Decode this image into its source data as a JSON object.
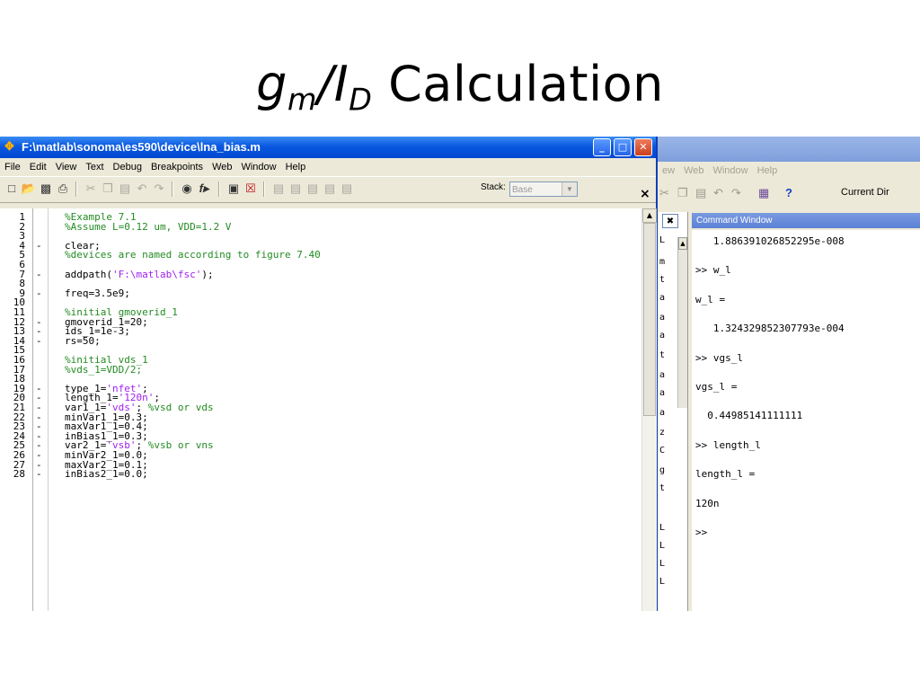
{
  "slide": {
    "title_main": "g",
    "title_sub_m": "m",
    "title_sep": "/I",
    "title_sub_d": "D",
    "title_rest": " Calculation"
  },
  "editor": {
    "title": "F:\\matlab\\sonoma\\es590\\device\\lna_bias.m",
    "window_buttons": [
      "_",
      "□",
      "✕"
    ],
    "menu": [
      "File",
      "Edit",
      "View",
      "Text",
      "Debug",
      "Breakpoints",
      "Web",
      "Window",
      "Help"
    ],
    "stack_label": "Stack:",
    "stack_value": "Base",
    "lines": [
      {
        "n": "1",
        "m": "",
        "code": [
          {
            "t": "%Example 7.1",
            "k": "cmt"
          }
        ]
      },
      {
        "n": "2",
        "m": "",
        "code": [
          {
            "t": "%Assume L=0.12 um, VDD=1.2 V",
            "k": "cmt"
          }
        ]
      },
      {
        "n": "3",
        "m": "",
        "code": []
      },
      {
        "n": "4",
        "m": "-",
        "code": [
          {
            "t": "clear;",
            "k": ""
          }
        ]
      },
      {
        "n": "5",
        "m": "",
        "code": [
          {
            "t": "%devices are named according to figure 7.40",
            "k": "cmt"
          }
        ]
      },
      {
        "n": "6",
        "m": "",
        "code": []
      },
      {
        "n": "7",
        "m": "-",
        "code": [
          {
            "t": "addpath(",
            "k": ""
          },
          {
            "t": "'F:\\matlab\\fsc'",
            "k": "str"
          },
          {
            "t": ");",
            "k": ""
          }
        ]
      },
      {
        "n": "8",
        "m": "",
        "code": []
      },
      {
        "n": "9",
        "m": "-",
        "code": [
          {
            "t": "freq=3.5e9;",
            "k": ""
          }
        ]
      },
      {
        "n": "10",
        "m": "",
        "code": []
      },
      {
        "n": "11",
        "m": "",
        "code": [
          {
            "t": "%initial gmoverid_1",
            "k": "cmt"
          }
        ]
      },
      {
        "n": "12",
        "m": "-",
        "code": [
          {
            "t": "gmoverid_1=20;",
            "k": ""
          }
        ]
      },
      {
        "n": "13",
        "m": "-",
        "code": [
          {
            "t": "ids_1=1e-3;",
            "k": ""
          }
        ]
      },
      {
        "n": "14",
        "m": "-",
        "code": [
          {
            "t": "rs=50;",
            "k": ""
          }
        ]
      },
      {
        "n": "15",
        "m": "",
        "code": []
      },
      {
        "n": "16",
        "m": "",
        "code": [
          {
            "t": "%initial vds_1",
            "k": "cmt"
          }
        ]
      },
      {
        "n": "17",
        "m": "",
        "code": [
          {
            "t": "%vds_1=VDD/2;",
            "k": "cmt"
          }
        ]
      },
      {
        "n": "18",
        "m": "",
        "code": []
      },
      {
        "n": "19",
        "m": "-",
        "code": [
          {
            "t": "type_1=",
            "k": ""
          },
          {
            "t": "'nfet'",
            "k": "str"
          },
          {
            "t": ";",
            "k": ""
          }
        ]
      },
      {
        "n": "20",
        "m": "-",
        "code": [
          {
            "t": "length_1=",
            "k": ""
          },
          {
            "t": "'120n'",
            "k": "str"
          },
          {
            "t": ";",
            "k": ""
          }
        ]
      },
      {
        "n": "21",
        "m": "-",
        "code": [
          {
            "t": "var1_1=",
            "k": ""
          },
          {
            "t": "'vds'",
            "k": "str"
          },
          {
            "t": "; ",
            "k": ""
          },
          {
            "t": "%vsd or vds",
            "k": "cmt"
          }
        ]
      },
      {
        "n": "22",
        "m": "-",
        "code": [
          {
            "t": "minVar1_1=0.3;",
            "k": ""
          }
        ]
      },
      {
        "n": "23",
        "m": "-",
        "code": [
          {
            "t": "maxVar1_1=0.4;",
            "k": ""
          }
        ]
      },
      {
        "n": "24",
        "m": "-",
        "code": [
          {
            "t": "inBias1_1=0.3;",
            "k": ""
          }
        ]
      },
      {
        "n": "25",
        "m": "-",
        "code": [
          {
            "t": "var2_1=",
            "k": ""
          },
          {
            "t": "'vsb'",
            "k": "str"
          },
          {
            "t": "; ",
            "k": ""
          },
          {
            "t": "%vsb or vns",
            "k": "cmt"
          }
        ]
      },
      {
        "n": "26",
        "m": "-",
        "code": [
          {
            "t": "minVar2_1=0.0;",
            "k": ""
          }
        ]
      },
      {
        "n": "27",
        "m": "-",
        "code": [
          {
            "t": "maxVar2_1=0.1;",
            "k": ""
          }
        ]
      },
      {
        "n": "28",
        "m": "-",
        "code": [
          {
            "t": "inBias2_1=0.0;",
            "k": ""
          }
        ]
      }
    ]
  },
  "desktop": {
    "menu": [
      "ew",
      "Web",
      "Window",
      "Help"
    ],
    "current_dir": "Current Dir",
    "close_label": "×",
    "side_letters": [
      "L",
      "m",
      "t",
      "a",
      "a",
      "a",
      "t",
      "a",
      "a",
      "a",
      "z",
      "C",
      "g",
      "t",
      "L",
      "L",
      "L",
      "L"
    ]
  },
  "command_window": {
    "title": "Command Window",
    "lines": [
      "   1.886391026852295e-008",
      "",
      ">> w_l",
      "",
      "w_l =",
      "",
      "   1.324329852307793e-004",
      "",
      ">> vgs_l",
      "",
      "vgs_l =",
      "",
      "  0.44985141111111",
      "",
      ">> length_l",
      "",
      "length_l =",
      "",
      "120n",
      "",
      ">>"
    ]
  }
}
